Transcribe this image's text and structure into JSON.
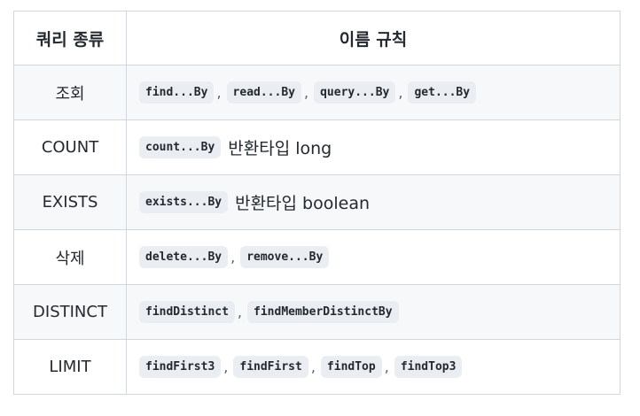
{
  "header": {
    "col_type": "쿼리 종류",
    "col_rule": "이름 규칙"
  },
  "rows": [
    {
      "type": "조회",
      "codes": [
        "find...By",
        "read...By",
        "query...By",
        "get...By"
      ],
      "note": ""
    },
    {
      "type": "COUNT",
      "codes": [
        "count...By"
      ],
      "note": "반환타입 long"
    },
    {
      "type": "EXISTS",
      "codes": [
        "exists...By"
      ],
      "note": "반환타입 boolean"
    },
    {
      "type": "삭제",
      "codes": [
        "delete...By",
        "remove...By"
      ],
      "note": ""
    },
    {
      "type": "DISTINCT",
      "codes": [
        "findDistinct",
        "findMemberDistinctBy"
      ],
      "note": ""
    },
    {
      "type": "LIMIT",
      "codes": [
        "findFirst3",
        "findFirst",
        "findTop",
        "findTop3"
      ],
      "note": ""
    }
  ],
  "separator": ","
}
